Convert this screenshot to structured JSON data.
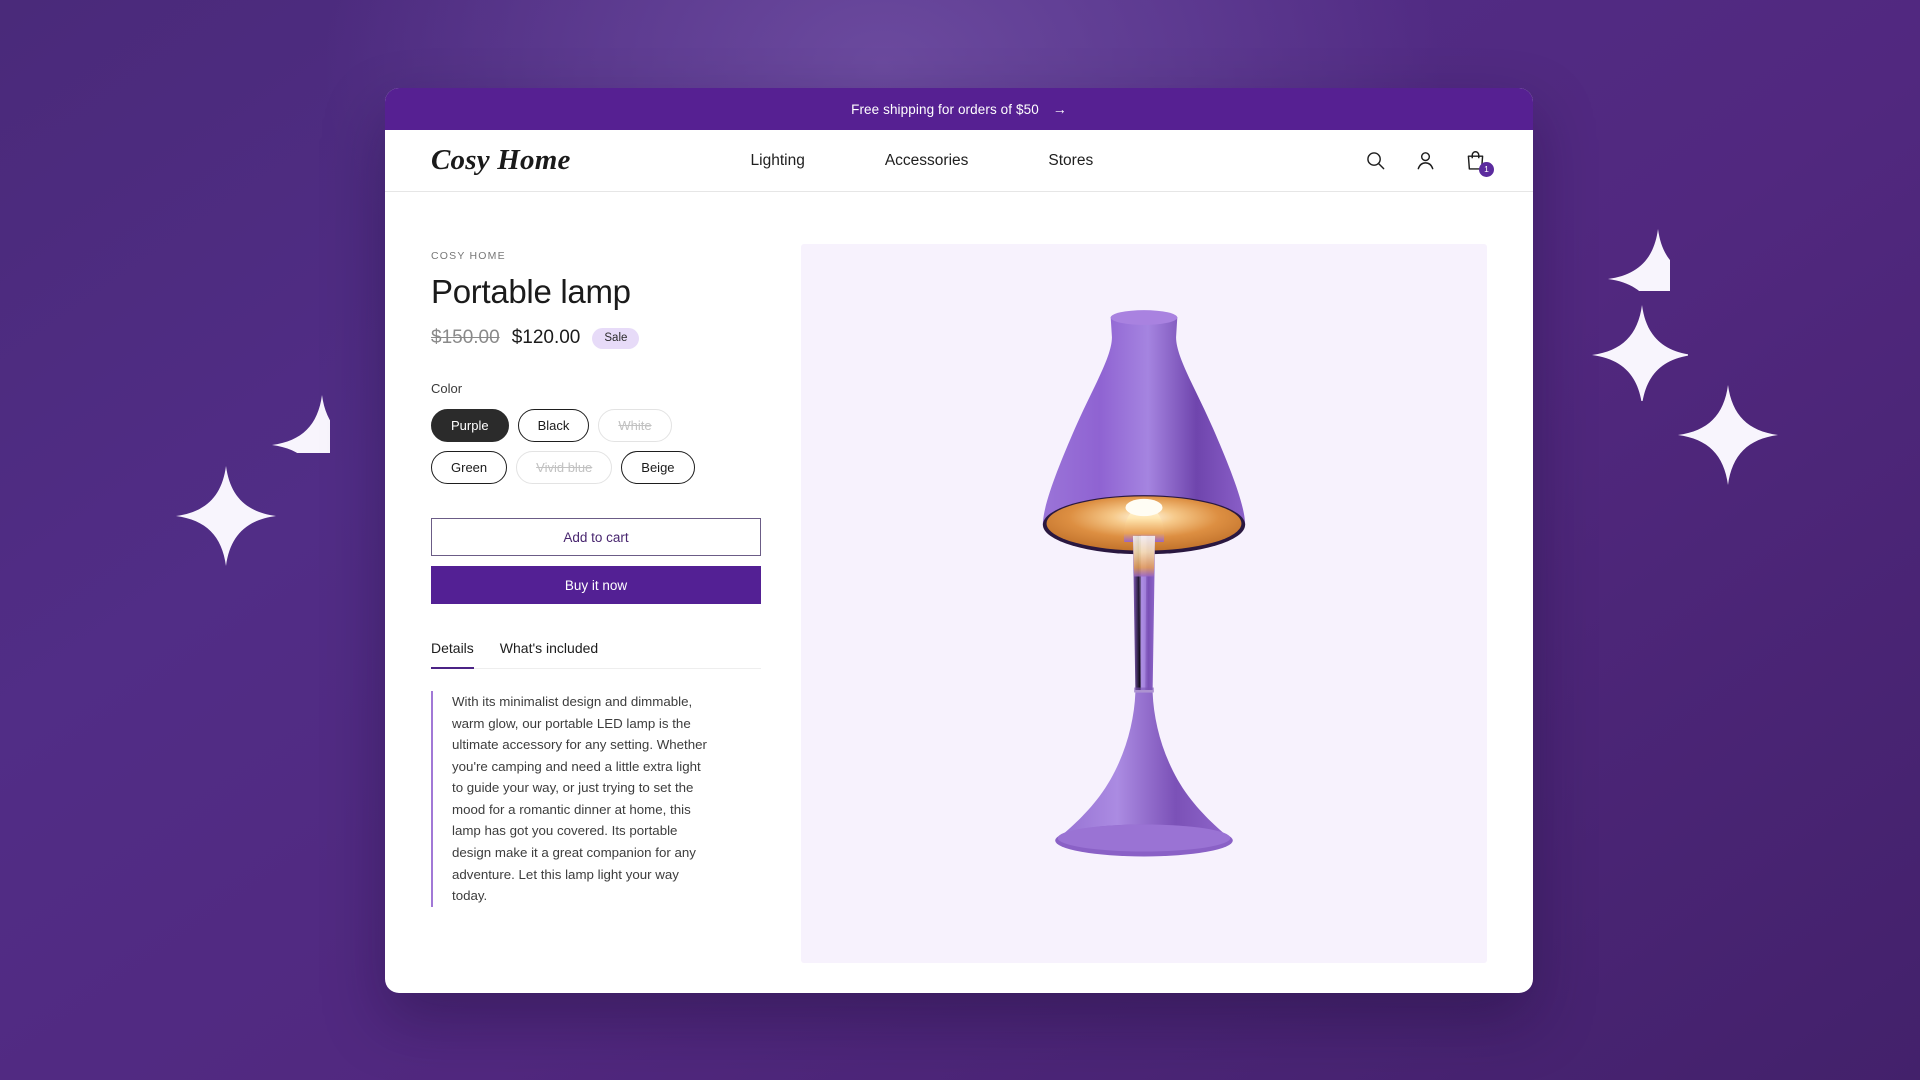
{
  "announcement": {
    "text": "Free shipping for orders of $50",
    "arrow": "→"
  },
  "nav": {
    "logo": "Cosy Home",
    "links": [
      {
        "label": "Lighting"
      },
      {
        "label": "Accessories"
      },
      {
        "label": "Stores"
      }
    ],
    "icons": {
      "search": "search-icon",
      "account": "user-icon",
      "cart": "shopping-bag-icon"
    },
    "cart_count": "1"
  },
  "product": {
    "vendor": "COSY HOME",
    "title": "Portable lamp",
    "price_compare_at": "$150.00",
    "price_current": "$120.00",
    "sale_badge": "Sale",
    "color_label": "Color",
    "color_options": [
      {
        "label": "Purple",
        "state": "selected"
      },
      {
        "label": "Black",
        "state": "available"
      },
      {
        "label": "White",
        "state": "unavailable"
      },
      {
        "label": "Green",
        "state": "available"
      },
      {
        "label": "Vivid blue",
        "state": "unavailable"
      },
      {
        "label": "Beige",
        "state": "available"
      }
    ],
    "add_to_cart_label": "Add to cart",
    "buy_now_label": "Buy it now",
    "tabs": [
      {
        "label": "Details",
        "active": true
      },
      {
        "label": "What's included",
        "active": false
      }
    ],
    "description": "With its minimalist design and dimmable, warm glow, our portable LED lamp is the ultimate accessory for any setting. Whether you're camping and need a little extra light to guide your way, or just trying to set the mood for a romantic dinner at home, this lamp has got you covered. Its portable design make it a great companion for any adventure. Let this lamp light your way today.",
    "image_alt": "purple-portable-lamp"
  },
  "colors": {
    "brand_purple": "#562092",
    "buy_now_purple": "#532094",
    "sale_badge_bg": "#e7dbf8",
    "image_panel_bg": "#f7f2fd",
    "backdrop_purple": "#512d86",
    "sparkle_white": "#f8f5fd",
    "selected_swatch": "#2b2b2b"
  }
}
